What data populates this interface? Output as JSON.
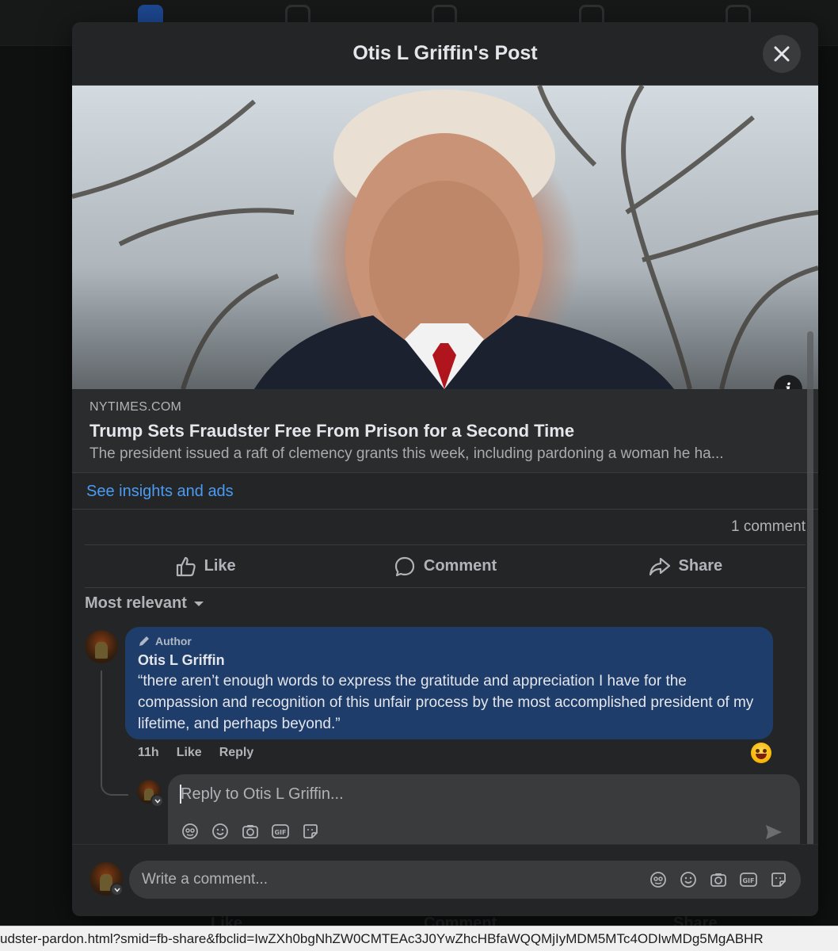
{
  "modal": {
    "title": "Otis L Griffin's Post"
  },
  "link_preview": {
    "domain": "NYTIMES.COM",
    "title": "Trump Sets Fraudster Free From Prison for a Second Time",
    "description": "The president issued a raft of clemency grants this week, including pardoning a woman he ha...",
    "info_icon_glyph": "i"
  },
  "insights_link": "See insights and ads",
  "stats": {
    "comment_count": "1 comment"
  },
  "actions": {
    "like": "Like",
    "comment": "Comment",
    "share": "Share"
  },
  "sort": {
    "label": "Most relevant"
  },
  "comment": {
    "badge": "Author",
    "author": "Otis L Griffin",
    "text": "“there aren’t enough words to express the gratitude and appreciation I have for the compassion and recognition of this unfair process by the most accomplished president of my lifetime, and perhaps beyond.”",
    "time": "11h",
    "like": "Like",
    "reply": "Reply",
    "reaction": "haha"
  },
  "reply_box": {
    "placeholder": "Reply to Otis L Griffin..."
  },
  "write_box": {
    "placeholder": "Write a comment..."
  },
  "tool_icons": [
    "avatar-sticker-icon",
    "emoji-icon",
    "camera-icon",
    "gif-icon",
    "sticker-icon"
  ],
  "background": {
    "like": "Like",
    "comment": "Comment",
    "share": "Share"
  },
  "status_url": "udster-pardon.html?smid=fb-share&fbclid=IwZXh0bgNhZW0CMTEAc3J0YwZhcHBfaWQQMjIyMDM5MTc4ODIwMDg5MgABHR"
}
